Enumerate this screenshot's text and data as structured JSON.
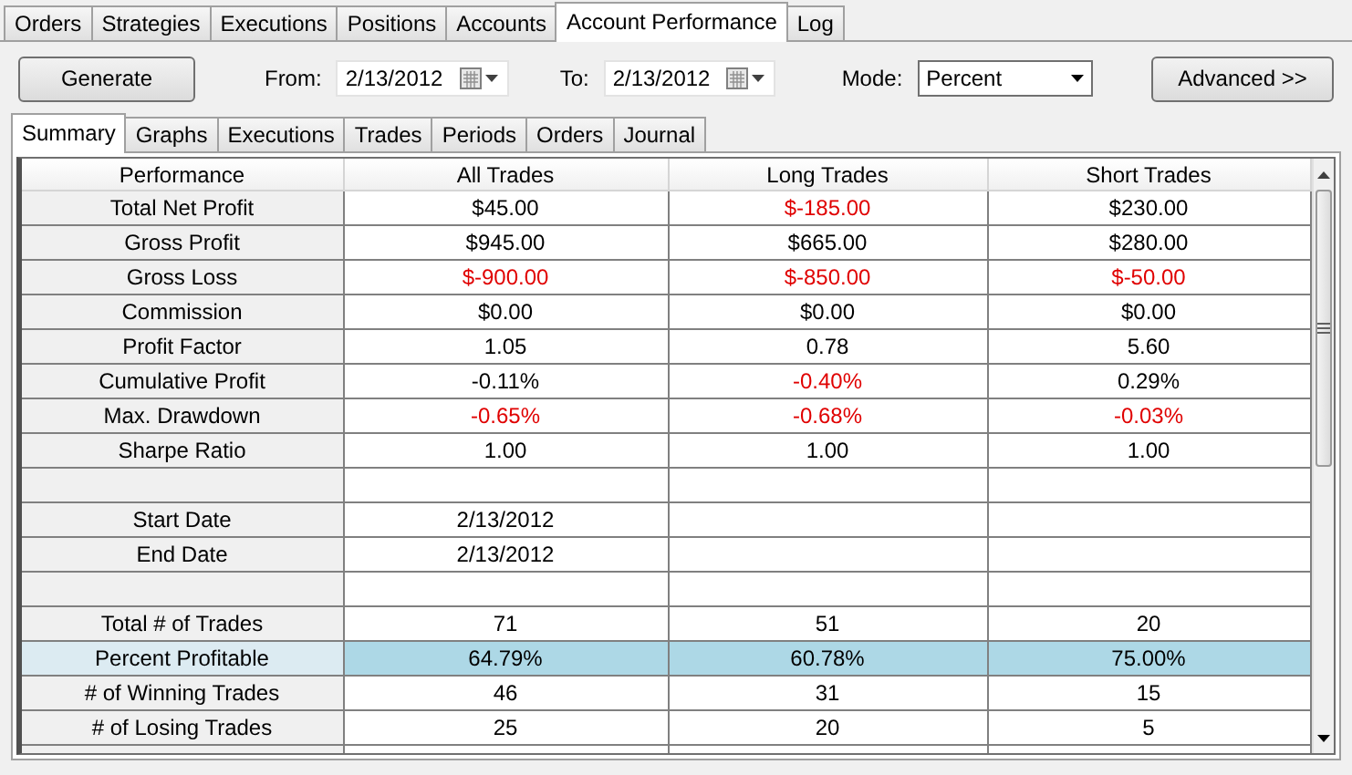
{
  "main_tabs": [
    {
      "label": "Orders",
      "selected": false
    },
    {
      "label": "Strategies",
      "selected": false
    },
    {
      "label": "Executions",
      "selected": false
    },
    {
      "label": "Positions",
      "selected": false
    },
    {
      "label": "Accounts",
      "selected": false
    },
    {
      "label": "Account Performance",
      "selected": true
    },
    {
      "label": "Log",
      "selected": false
    }
  ],
  "toolbar": {
    "generate_button": "Generate",
    "from_label": "From:",
    "from_value": "2/13/2012",
    "to_label": "To:",
    "to_value": "2/13/2012",
    "mode_label": "Mode:",
    "mode_value": "Percent",
    "advanced_button": "Advanced >>"
  },
  "sub_tabs": [
    {
      "label": "Summary",
      "selected": true
    },
    {
      "label": "Graphs",
      "selected": false
    },
    {
      "label": "Executions",
      "selected": false
    },
    {
      "label": "Trades",
      "selected": false
    },
    {
      "label": "Periods",
      "selected": false
    },
    {
      "label": "Orders",
      "selected": false
    },
    {
      "label": "Journal",
      "selected": false
    }
  ],
  "table": {
    "columns": [
      "Performance",
      "All Trades",
      "Long Trades",
      "Short Trades"
    ],
    "rows": [
      {
        "kind": "data",
        "label": "Total Net Profit",
        "selected": false,
        "cells": [
          {
            "text": "$45.00",
            "negative": false
          },
          {
            "text": "$-185.00",
            "negative": true
          },
          {
            "text": "$230.00",
            "negative": false
          }
        ]
      },
      {
        "kind": "data",
        "label": "Gross Profit",
        "selected": false,
        "cells": [
          {
            "text": "$945.00",
            "negative": false
          },
          {
            "text": "$665.00",
            "negative": false
          },
          {
            "text": "$280.00",
            "negative": false
          }
        ]
      },
      {
        "kind": "data",
        "label": "Gross Loss",
        "selected": false,
        "cells": [
          {
            "text": "$-900.00",
            "negative": true
          },
          {
            "text": "$-850.00",
            "negative": true
          },
          {
            "text": "$-50.00",
            "negative": true
          }
        ]
      },
      {
        "kind": "data",
        "label": "Commission",
        "selected": false,
        "cells": [
          {
            "text": "$0.00",
            "negative": false
          },
          {
            "text": "$0.00",
            "negative": false
          },
          {
            "text": "$0.00",
            "negative": false
          }
        ]
      },
      {
        "kind": "data",
        "label": "Profit Factor",
        "selected": false,
        "cells": [
          {
            "text": "1.05",
            "negative": false
          },
          {
            "text": "0.78",
            "negative": false
          },
          {
            "text": "5.60",
            "negative": false
          }
        ]
      },
      {
        "kind": "data",
        "label": "Cumulative Profit",
        "selected": false,
        "cells": [
          {
            "text": "-0.11%",
            "negative": false
          },
          {
            "text": "-0.40%",
            "negative": true
          },
          {
            "text": "0.29%",
            "negative": false
          }
        ]
      },
      {
        "kind": "data",
        "label": "Max. Drawdown",
        "selected": false,
        "cells": [
          {
            "text": "-0.65%",
            "negative": true
          },
          {
            "text": "-0.68%",
            "negative": true
          },
          {
            "text": "-0.03%",
            "negative": true
          }
        ]
      },
      {
        "kind": "data",
        "label": "Sharpe Ratio",
        "selected": false,
        "cells": [
          {
            "text": "1.00",
            "negative": false
          },
          {
            "text": "1.00",
            "negative": false
          },
          {
            "text": "1.00",
            "negative": false
          }
        ]
      },
      {
        "kind": "blank"
      },
      {
        "kind": "data",
        "label": "Start Date",
        "selected": false,
        "cells": [
          {
            "text": "2/13/2012",
            "negative": false
          }
        ]
      },
      {
        "kind": "data",
        "label": "End Date",
        "selected": false,
        "cells": [
          {
            "text": "2/13/2012",
            "negative": false
          }
        ]
      },
      {
        "kind": "blank"
      },
      {
        "kind": "data",
        "label": "Total # of Trades",
        "selected": false,
        "cells": [
          {
            "text": "71",
            "negative": false
          },
          {
            "text": "51",
            "negative": false
          },
          {
            "text": "20",
            "negative": false
          }
        ]
      },
      {
        "kind": "data",
        "label": "Percent Profitable",
        "selected": true,
        "cells": [
          {
            "text": "64.79%",
            "negative": false
          },
          {
            "text": "60.78%",
            "negative": false
          },
          {
            "text": "75.00%",
            "negative": false
          }
        ]
      },
      {
        "kind": "data",
        "label": "# of Winning Trades",
        "selected": false,
        "cells": [
          {
            "text": "46",
            "negative": false
          },
          {
            "text": "31",
            "negative": false
          },
          {
            "text": "15",
            "negative": false
          }
        ]
      },
      {
        "kind": "data",
        "label": "# of Losing Trades",
        "selected": false,
        "cells": [
          {
            "text": "25",
            "negative": false
          },
          {
            "text": "20",
            "negative": false
          },
          {
            "text": "5",
            "negative": false
          }
        ]
      }
    ]
  }
}
